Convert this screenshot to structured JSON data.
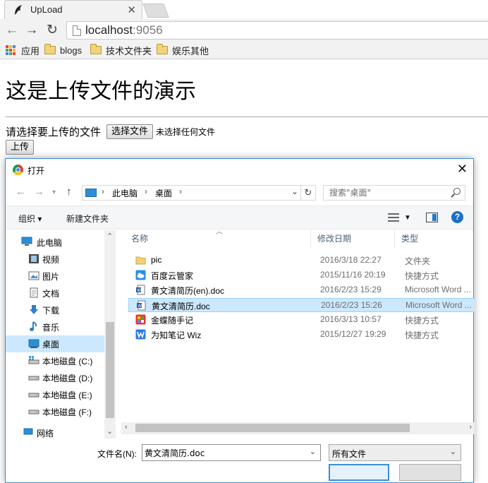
{
  "browser": {
    "tab_title": "UpLoad",
    "url_host": "localhost",
    "url_port": ":9056",
    "bookmarks": [
      "应用",
      "blogs",
      "技术文件夹",
      "娱乐其他"
    ]
  },
  "page": {
    "heading": "这是上传文件的演示",
    "choose_label": "请选择要上传的文件",
    "choose_button": "选择文件",
    "no_file_text": "未选择任何文件",
    "upload_button": "上传"
  },
  "dialog": {
    "title": "打开",
    "breadcrumb": [
      "此电脑",
      "桌面"
    ],
    "search_placeholder": "搜索\"桌面\"",
    "organize": "组织 ▾",
    "new_folder": "新建文件夹",
    "sidebar": [
      {
        "label": "此电脑",
        "icon": "pc-icon"
      },
      {
        "label": "视频",
        "icon": "video-icon"
      },
      {
        "label": "图片",
        "icon": "pictures-icon"
      },
      {
        "label": "文档",
        "icon": "documents-icon"
      },
      {
        "label": "下载",
        "icon": "download-icon"
      },
      {
        "label": "音乐",
        "icon": "music-icon"
      },
      {
        "label": "桌面",
        "icon": "desktop-icon",
        "selected": true
      },
      {
        "label": "本地磁盘 (C:)",
        "icon": "drive-icon"
      },
      {
        "label": "本地磁盘 (D:)",
        "icon": "drive-icon"
      },
      {
        "label": "本地磁盘 (E:)",
        "icon": "drive-icon"
      },
      {
        "label": "本地磁盘 (F:)",
        "icon": "drive-icon"
      },
      {
        "label": "网络",
        "icon": "network-icon"
      }
    ],
    "columns": {
      "name": "名称",
      "date": "修改日期",
      "type": "类型"
    },
    "files": [
      {
        "name": "pic",
        "date": "2016/3/18 22:27",
        "type": "文件夹",
        "icon": "folder-icon"
      },
      {
        "name": "百度云管家",
        "date": "2015/11/16 20:19",
        "type": "快捷方式",
        "icon": "baidu-cloud-icon"
      },
      {
        "name": "黄文清简历(en).doc",
        "date": "2016/2/23 15:29",
        "type": "Microsoft Word ...",
        "icon": "word-doc-icon"
      },
      {
        "name": "黄文清简历.doc",
        "date": "2016/2/23 15:26",
        "type": "Microsoft Word ...",
        "icon": "word-doc-icon",
        "selected": true
      },
      {
        "name": "金蝶随手记",
        "date": "2016/3/13 10:57",
        "type": "快捷方式",
        "icon": "app-shortcut-icon"
      },
      {
        "name": "为知笔记 Wiz",
        "date": "2015/12/27 19:29",
        "type": "快捷方式",
        "icon": "wiz-icon"
      }
    ],
    "filename_label": "文件名(N):",
    "filename_value": "黄文清简历.doc",
    "filter_value": "所有文件"
  },
  "colors": {
    "selection": "#cce8ff",
    "dialog_border": "#3d90d6",
    "accent_blue": "#1a6fc9"
  }
}
